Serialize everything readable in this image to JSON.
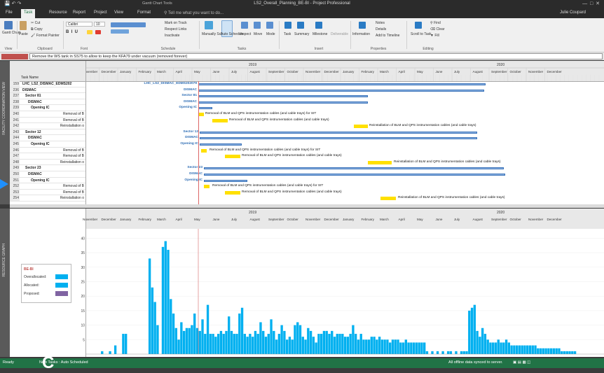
{
  "window": {
    "title": "LS2_Overall_Planning_BE-BI - Project Professional",
    "context_tab": "Gantt Chart Tools",
    "user": "Julie Coupard"
  },
  "tabs": [
    "File",
    "Task",
    "Resource",
    "Report",
    "Project",
    "View",
    "Format"
  ],
  "active_tab": "Task",
  "tell_me": "Tell me what you want to do...",
  "ribbon": {
    "groups": [
      "View",
      "Clipboard",
      "Font",
      "Schedule",
      "Tasks",
      "Insert",
      "Properties",
      "Editing"
    ],
    "gantt_chart": "Gantt Chart",
    "paste": "Paste",
    "cut": "Cut",
    "copy": "Copy",
    "format_painter": "Format Painter",
    "font_name": "Calibri",
    "font_size": "10",
    "mark_on_track": "Mark on Track",
    "respect_links": "Respect Links",
    "inactivate": "Inactivate",
    "manually_schedule": "Manually Schedule",
    "auto_schedule": "Auto Schedule",
    "inspect": "Inspect",
    "move": "Move",
    "mode": "Mode",
    "task": "Task",
    "summary": "Summary",
    "milestone": "Milestone",
    "deliverable": "Deliverable",
    "information": "Information",
    "notes": "Notes",
    "details": "Details",
    "add_to_timeline": "Add to Timeline",
    "scroll_to_task": "Scroll to Task",
    "find": "Find",
    "clear": "Clear",
    "fill": "Fill"
  },
  "entry_bar": "Remove the WS tank in SS75 to allow to keep the KFA79 under vacuum (removed forever)",
  "view_labels": {
    "top": "FACILITY COORDINATION VIEW",
    "bottom": "RESOURCE GRAPH"
  },
  "table": {
    "header": "Task Name",
    "rows": [
      {
        "id": "159",
        "name": "LHC_LS2_DISMAC_EDMS202"
      },
      {
        "id": "236",
        "name": "DISMAC"
      },
      {
        "id": "237",
        "name": "Sector 81"
      },
      {
        "id": "238",
        "name": "DISMAC"
      },
      {
        "id": "239",
        "name": "Opening IC"
      },
      {
        "id": "240",
        "name": "Removal of B"
      },
      {
        "id": "241",
        "name": "Removal of B"
      },
      {
        "id": "242",
        "name": "Reinstallation o"
      },
      {
        "id": "243",
        "name": "Sector 12"
      },
      {
        "id": "244",
        "name": "DISMAC"
      },
      {
        "id": "245",
        "name": "Opening IC"
      },
      {
        "id": "246",
        "name": "Removal of B"
      },
      {
        "id": "247",
        "name": "Removal of B"
      },
      {
        "id": "248",
        "name": "Reinstallation o"
      },
      {
        "id": "249",
        "name": "Sector 23"
      },
      {
        "id": "250",
        "name": "DISMAC"
      },
      {
        "id": "251",
        "name": "Opening IC"
      },
      {
        "id": "252",
        "name": "Removal of B"
      },
      {
        "id": "253",
        "name": "Removal of B"
      },
      {
        "id": "254",
        "name": "Reinstallation o"
      }
    ]
  },
  "timescale": {
    "years": [
      "2019",
      "2020"
    ],
    "months": [
      "November",
      "December",
      "January",
      "February",
      "March",
      "April",
      "May",
      "June",
      "July",
      "August",
      "September",
      "October",
      "November",
      "December",
      "January",
      "February",
      "March",
      "April",
      "May",
      "June",
      "July",
      "August",
      "September",
      "October",
      "November",
      "December"
    ]
  },
  "gantt_labels": {
    "top_summary": "LHC_LS2_DISMAC_EDMS202079",
    "dismac": "DISMAC",
    "sector81": "Sector 81",
    "sector12": "Sector 12",
    "sector23": "Sector 23",
    "opening": "Opening IC",
    "removal_sit": "Removal of BLM and QPS instrumentation cables (and cable trays) for SIT",
    "removal": "Removal of BLM and QPS instrumentation cables (and cable trays)",
    "reinstall": "Reinstallation of BLM and QPS instrumentation cables (and cable trays)"
  },
  "legend": {
    "resource": "BE-BI",
    "items": [
      {
        "label": "Overallocated:",
        "color": "#00b0f0"
      },
      {
        "label": "Allocated:",
        "color": "#00b0f0"
      },
      {
        "label": "Proposed:",
        "color": "#8064a2"
      }
    ]
  },
  "chart_data": {
    "type": "bar",
    "title": "",
    "xlabel": "",
    "ylabel": "",
    "ylim": [
      0,
      40
    ],
    "yticks": [
      5,
      10,
      15,
      20,
      25,
      30,
      35,
      40
    ],
    "categories_note": "",
    "values": [
      0,
      0,
      0,
      0,
      1,
      0,
      0,
      1,
      0,
      3,
      0,
      0,
      7,
      7,
      0,
      0,
      0,
      0,
      0,
      0,
      0,
      0,
      33,
      23,
      18,
      10,
      0,
      37,
      39,
      36,
      19,
      14,
      9,
      5,
      11,
      8,
      9,
      9,
      10,
      14,
      9,
      8,
      12,
      7,
      17,
      7,
      7,
      6,
      7,
      8,
      7,
      8,
      13,
      8,
      7,
      7,
      14,
      16,
      7,
      6,
      7,
      6,
      8,
      7,
      11,
      8,
      6,
      7,
      12,
      8,
      5,
      7,
      10,
      8,
      5,
      6,
      5,
      10,
      11,
      10,
      6,
      5,
      9,
      8,
      6,
      4,
      7,
      7,
      8,
      8,
      7,
      8,
      6,
      7,
      7,
      7,
      6,
      6,
      7,
      10,
      7,
      5,
      7,
      5,
      5,
      5,
      6,
      6,
      5,
      6,
      5,
      5,
      5,
      4,
      5,
      5,
      5,
      4,
      4,
      5,
      4,
      4,
      4,
      4,
      4,
      4,
      4,
      1,
      0,
      1,
      0,
      1,
      0,
      1,
      0,
      1,
      1,
      0,
      1,
      0,
      1,
      1,
      1,
      15,
      16,
      17,
      8,
      6,
      9,
      7,
      5,
      4,
      4,
      4,
      5,
      4,
      4,
      5,
      4,
      3,
      3,
      3,
      3,
      3,
      3,
      3,
      3,
      3,
      3,
      2,
      2,
      2,
      2,
      2,
      2,
      2,
      2,
      2,
      1,
      1,
      1,
      1,
      1,
      1
    ]
  },
  "status": {
    "ready": "Ready",
    "new_tasks": "New Tasks : Auto Scheduled",
    "sync": "All offline data synced to server."
  },
  "overlay_text": "C",
  "colors": {
    "accent": "#217346",
    "bar": "#00b0f0",
    "today": "#d66666"
  }
}
